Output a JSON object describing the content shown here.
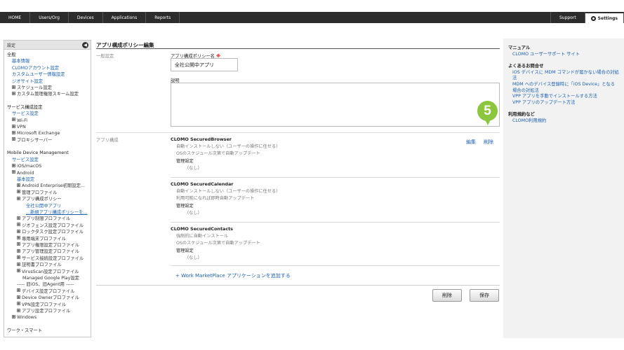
{
  "nav": {
    "items": [
      "HOME",
      "Users/Org",
      "Devices",
      "Applications",
      "Reports"
    ],
    "support": "Support",
    "settings": "Settings"
  },
  "sidebar": {
    "header": "設定",
    "collapse_icon": "chevron-left-icon",
    "sections": [
      {
        "title": "全般",
        "items": [
          "基本情報",
          "CLOMOアカウント設定",
          "カスタムユーザー情報設定",
          "ジオサイト設定",
          "スケジュール設定",
          "カスタム管理権限スキーム設定"
        ]
      },
      {
        "title": "サービス構成設定",
        "items": [
          "サービス設定",
          "Wi-Fi",
          "VPN",
          "Microsoft Exchange",
          "プロキシサーバー"
        ]
      },
      {
        "title": "Mobile Device Management",
        "items": [
          "サービス設定",
          "iOS/macOS",
          "Android",
          "基本設定",
          "Android Enterprise初期設定...",
          "管理プロファイル",
          "アプリ構成ポリシー",
          "全社公開中アプリ",
          "...新規アプリ構成ポリシーを...",
          "アプリ制限プロファイル",
          "ジオフェンス設定プロファイル",
          "ロックタスク設定プロファイル",
          "専用端末プロファイル",
          "アプリ権限設定プロファイル",
          "アプリ管理設定プロファイル",
          "サービス接続設定プロファイル",
          "証明書プロファイル",
          "VirusScan設定プロファイル",
          "Managed Google Play設定",
          "----- 旧iOS、旧Agent用 -----",
          "デバイス設定プロファイル",
          "Device Ownerプロファイル",
          "VPN設定プロファイル",
          "アプリ設定プロファイル",
          "Windows"
        ]
      },
      {
        "title": "ワーク・スマート",
        "items": []
      }
    ]
  },
  "main": {
    "title": "アプリ構成ポリシー編集",
    "general_label": "一般設定",
    "name_label": "アプリ構成ポリシー名",
    "required_mark": "※",
    "name_value": "全社公開中アプリ",
    "desc_label": "説明",
    "apps_label": "アプリ構成",
    "apps": [
      {
        "name": "CLOMO SecuredBrowser",
        "install": "自動インストールしない（ユーザーの操作に任せる）",
        "update": "OSのスケジュール次第で自動アップデート",
        "managed": "管理設定",
        "managed_value": "（なし）"
      },
      {
        "name": "CLOMO SecuredCalendar",
        "install": "自動インストールしない（ユーザーの操作に任せる）",
        "update": "利用可能になれば即時自動アップデート",
        "managed": "管理設定",
        "managed_value": "（なし）"
      },
      {
        "name": "CLOMO SecuredContacts",
        "install": "強制的に自動インストール",
        "update": "OSのスケジュール次第で自動アップデート",
        "managed": "管理設定",
        "managed_value": "（なし）"
      }
    ],
    "edit_link": "編集",
    "delete_link": "削除",
    "step_number": "5",
    "add_link": "+ Work MarketPlace アプリケーションを追加する",
    "delete_button": "削除",
    "save_button": "保存"
  },
  "right_panel": {
    "manual_heading": "マニュアル",
    "manual_links": [
      "CLOMO ユーザーサポート サイト"
    ],
    "faq_heading": "よくあるお問合せ",
    "faq_links": [
      "iOS デバイスに MDM コマンドが届かない場合の対処法",
      "MDM へのデバイス登録時に「iOS Device」となる場合の対処法",
      "VPP アプリを手動でインストールする方法",
      "VPP アプリのアップデート方法"
    ],
    "terms_heading": "利用規約など",
    "terms_links": [
      "CLOMO利用規約"
    ]
  },
  "colors": {
    "nav_bg": "#2c2c2c",
    "link": "#1a5fb0",
    "step_badge": "#8cc63f",
    "required": "#dd0000"
  }
}
